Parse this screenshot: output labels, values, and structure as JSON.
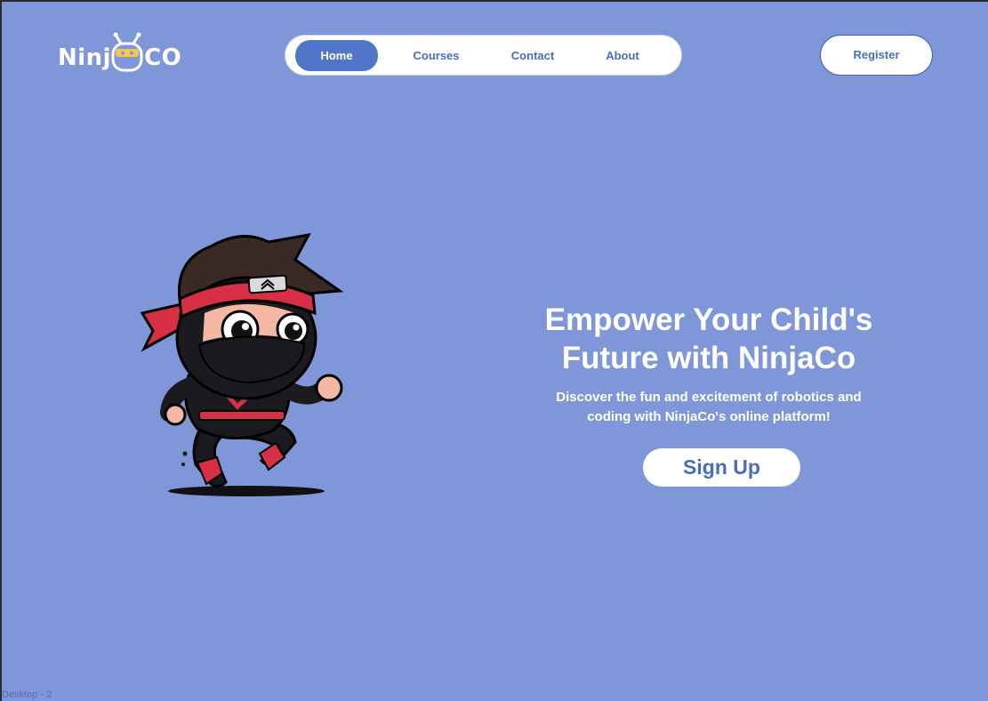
{
  "brand": {
    "logo_left": "Ninj",
    "logo_right": "CO"
  },
  "nav": {
    "items": [
      {
        "label": "Home",
        "active": true
      },
      {
        "label": "Courses",
        "active": false
      },
      {
        "label": "Contact",
        "active": false
      },
      {
        "label": "About",
        "active": false
      }
    ]
  },
  "header": {
    "register_label": "Register"
  },
  "hero": {
    "title_line1": "Empower Your Child's",
    "title_line2": "Future with NinjaCo",
    "subtitle_line1": "Discover the fun and excitement of robotics and",
    "subtitle_line2": "coding with NinjaCo's online platform!",
    "cta_label": "Sign Up"
  },
  "canvas": {
    "frame_label": "Desktop - 2"
  },
  "colors": {
    "background": "#7f96d9",
    "accent": "#4f76c8",
    "white": "#ffffff",
    "ninja_red": "#d72f45",
    "ninja_black": "#1b1b1f"
  },
  "icons": {
    "logo_robot": "robot-head-icon",
    "mascot": "ninja-mascot"
  }
}
